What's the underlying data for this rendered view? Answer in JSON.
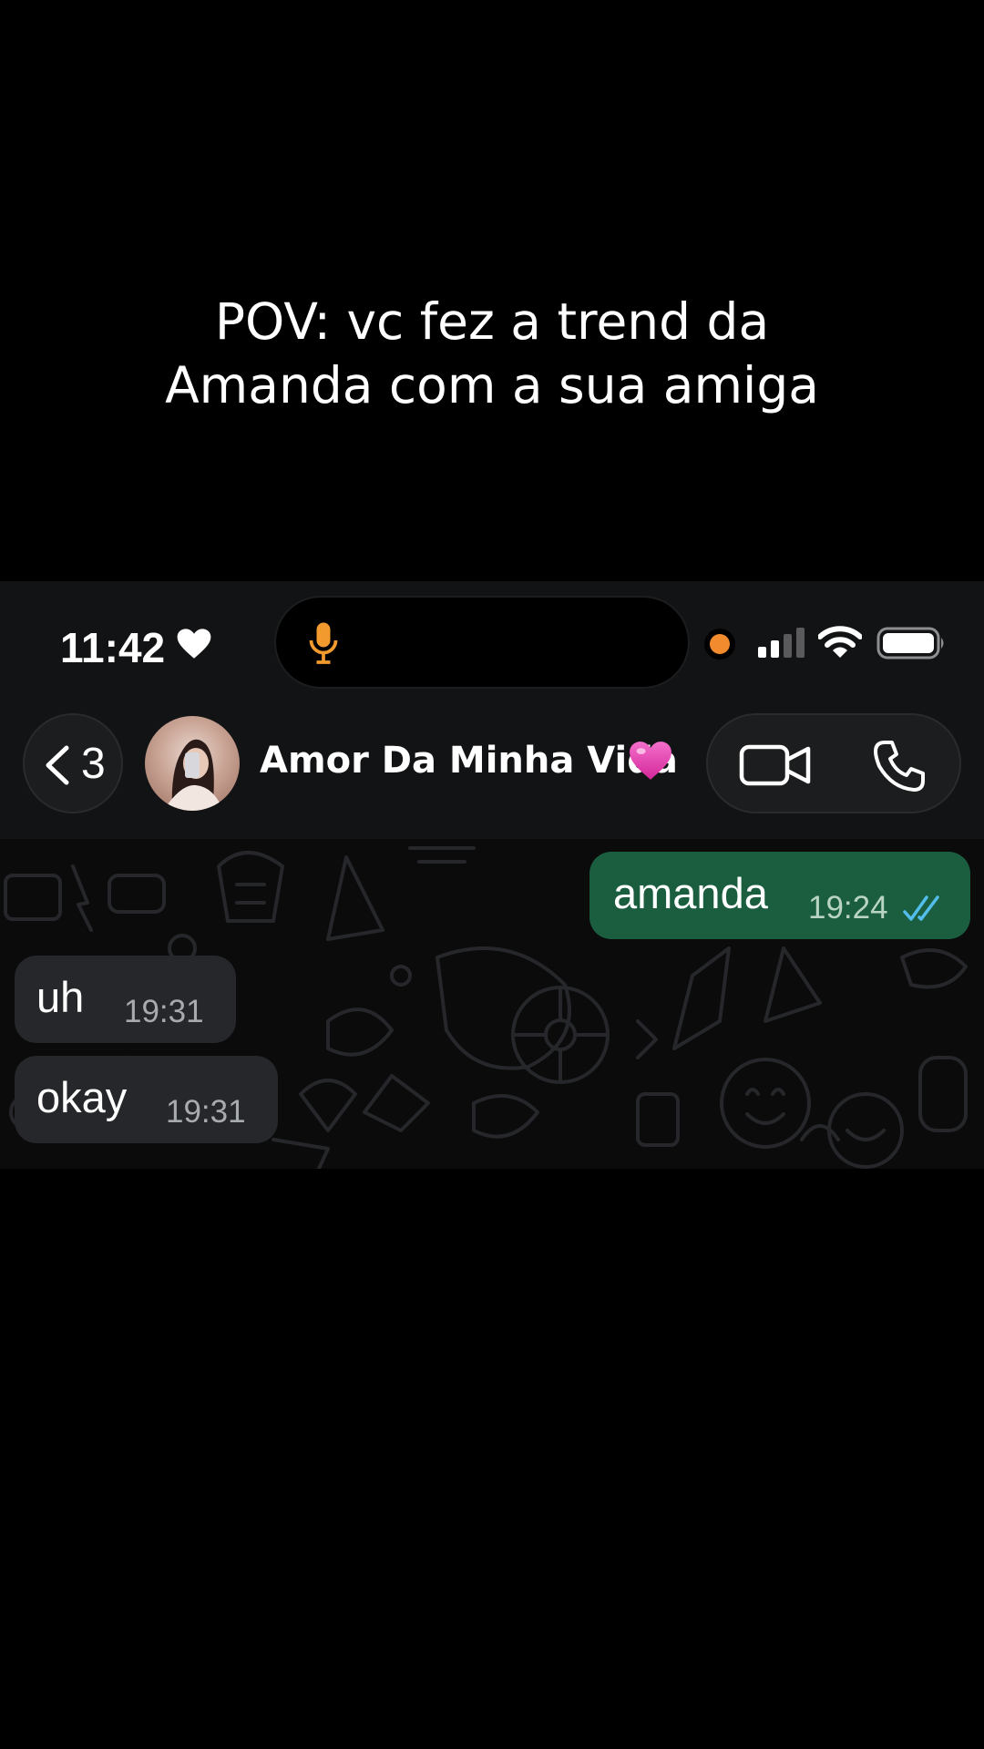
{
  "caption": {
    "line1": "POV: vc fez a trend da",
    "line2": "Amanda com a sua amiga"
  },
  "status_bar": {
    "time": "11:42",
    "time_icon": "heart-icon",
    "island_icon": "microphone-icon",
    "indicator_color": "#f28a2e",
    "icons": [
      "cellular-signal-icon",
      "wifi-icon",
      "battery-icon"
    ]
  },
  "header": {
    "back_count": "3",
    "contact_name": "Amor Da Minha Vida",
    "name_emoji": "pink-heart-icon",
    "actions": [
      "video-call-icon",
      "phone-call-icon"
    ]
  },
  "messages": [
    {
      "direction": "outgoing",
      "text": "amanda",
      "time": "19:24",
      "status": "read"
    },
    {
      "direction": "incoming",
      "text": "uh",
      "time": "19:31"
    },
    {
      "direction": "incoming",
      "text": "okay",
      "time": "19:31"
    }
  ],
  "colors": {
    "outgoing_bubble": "#1b5e3f",
    "incoming_bubble": "#26272a",
    "read_ticks": "#53bdeb",
    "mic_accent": "#f29a2e",
    "heart_emoji": "#e83fb0"
  }
}
